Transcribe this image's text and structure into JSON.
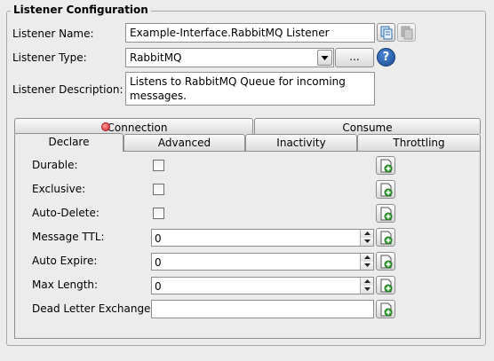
{
  "group": {
    "title": "Listener Configuration"
  },
  "form": {
    "name_label": "Listener Name:",
    "name_value": "Example-Interface.RabbitMQ Listener",
    "type_label": "Listener Type:",
    "type_value": "RabbitMQ",
    "browse_label": "...",
    "help_glyph": "?",
    "description_label": "Listener Description:",
    "description_value": "Listens to RabbitMQ Queue for incoming messages."
  },
  "tabs": {
    "row1": [
      "Connection",
      "Consume"
    ],
    "row2": [
      "Declare",
      "Advanced",
      "Inactivity",
      "Throttling"
    ],
    "active": "Declare",
    "connection_status_color": "#e03a3a"
  },
  "declare": {
    "durable": {
      "label": "Durable:",
      "checked": false
    },
    "exclusive": {
      "label": "Exclusive:",
      "checked": false
    },
    "auto_delete": {
      "label": "Auto-Delete:",
      "checked": false
    },
    "message_ttl": {
      "label": "Message TTL:",
      "value": "0"
    },
    "auto_expire": {
      "label": "Auto Expire:",
      "value": "0"
    },
    "max_length": {
      "label": "Max Length:",
      "value": "0"
    },
    "dead_letter_exchange": {
      "label": "Dead Letter Exchange:",
      "value": ""
    }
  },
  "icons": {
    "copy": "copy-icon",
    "paste": "paste-icon",
    "dropdown": "chevron-down-icon",
    "help": "help-icon",
    "add_variable": "add-variable-icon"
  }
}
